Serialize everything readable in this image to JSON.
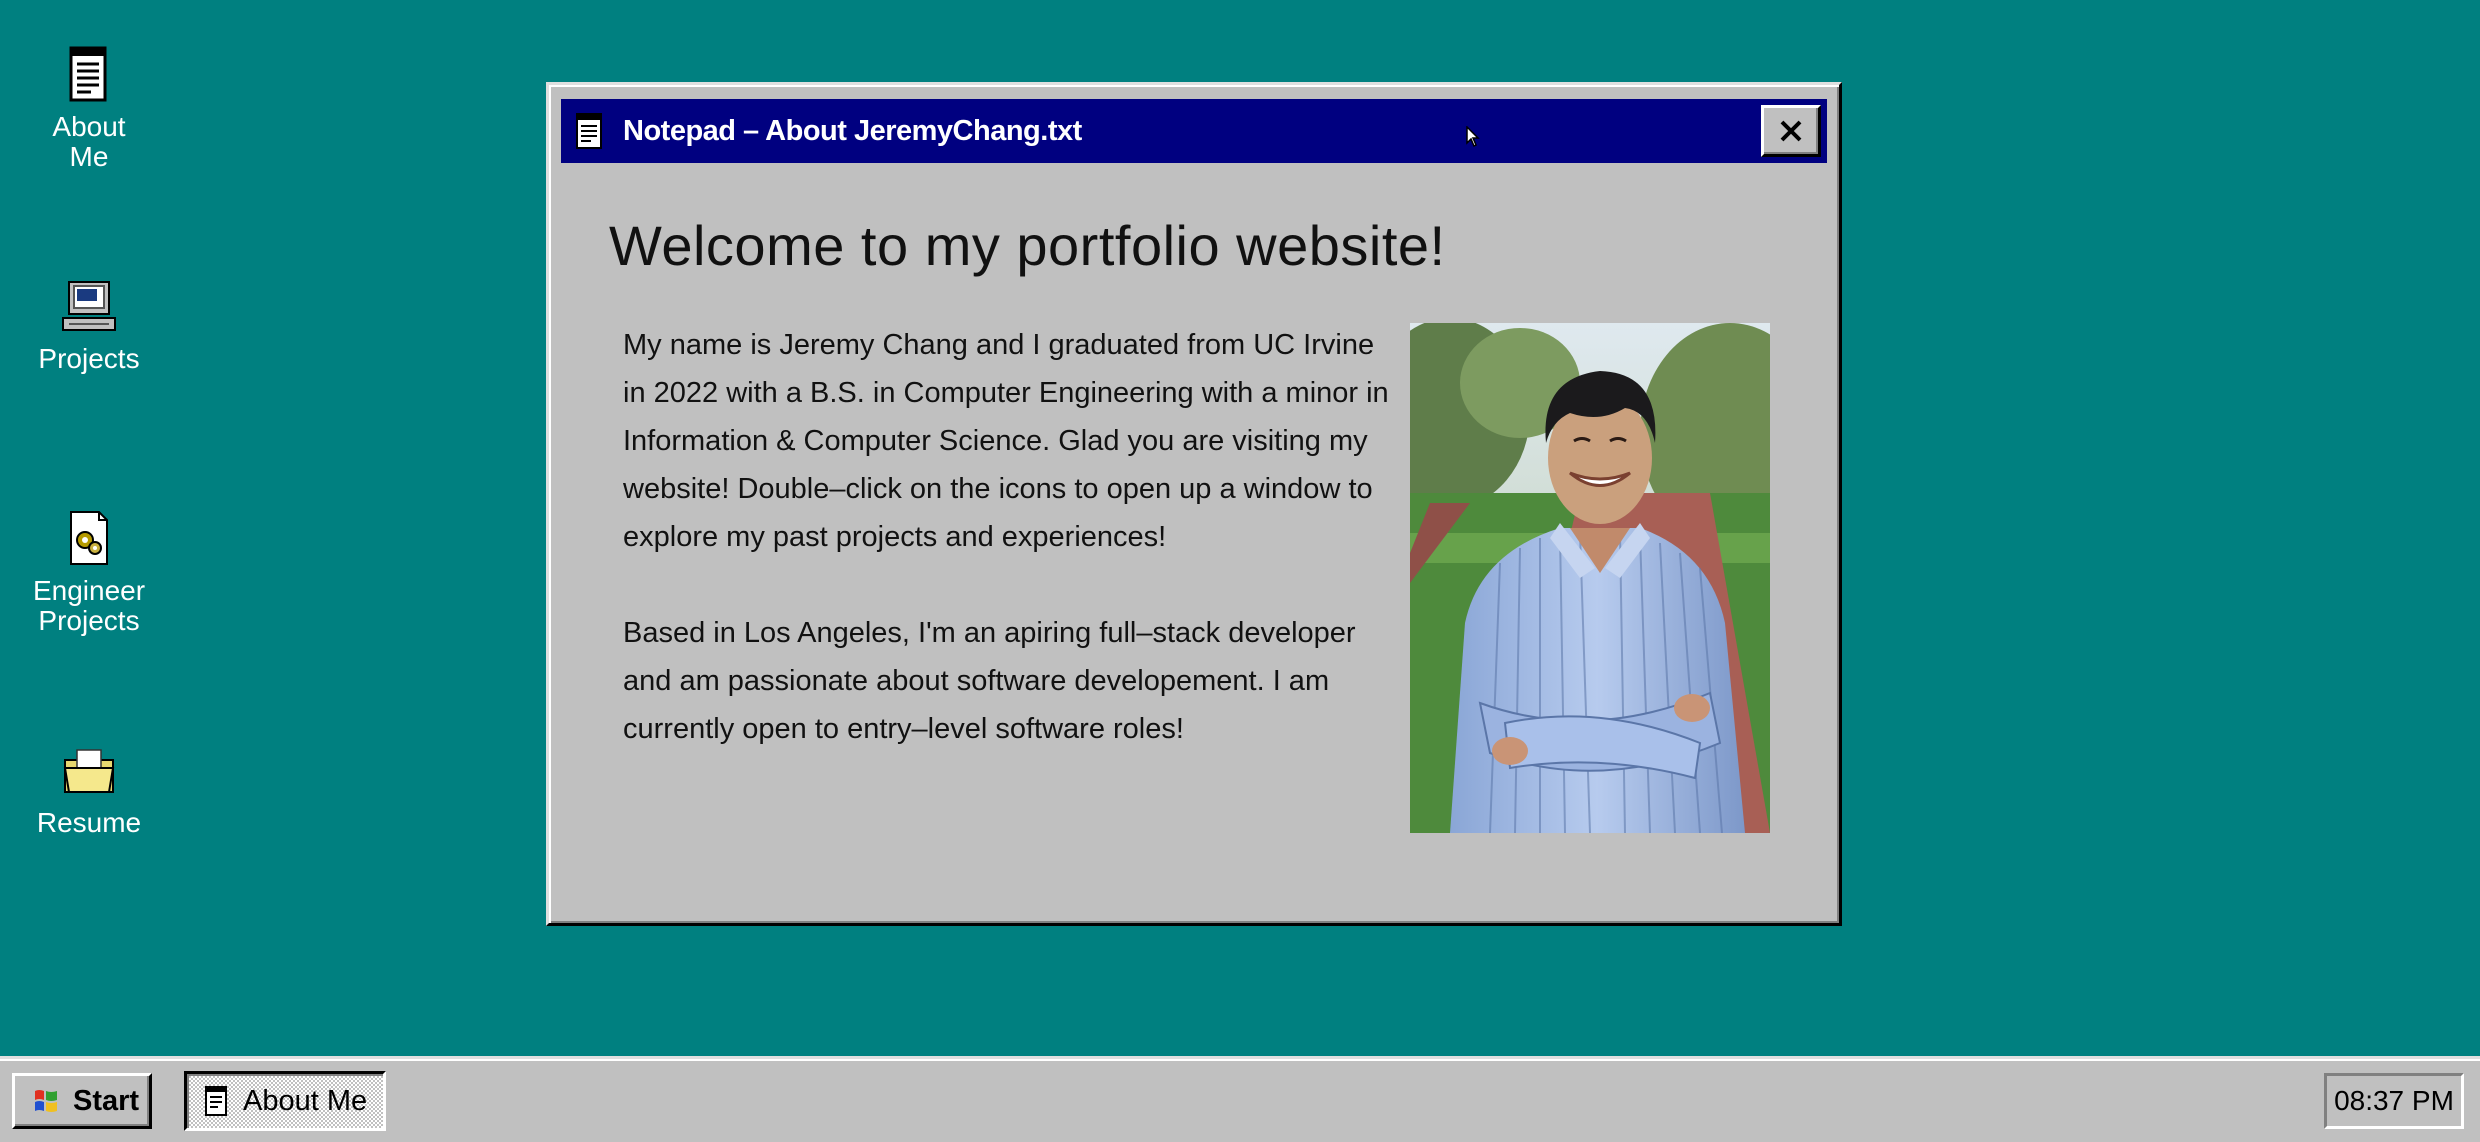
{
  "desktop": {
    "background": "#008080",
    "icons": [
      {
        "label": "About\nMe",
        "icon": "notepad-document-icon"
      },
      {
        "label": "Projects",
        "icon": "computer-icon"
      },
      {
        "label": "Engineer\nProjects",
        "icon": "settings-document-icon"
      },
      {
        "label": "Resume",
        "icon": "folder-icon"
      }
    ]
  },
  "window": {
    "title": "Notepad – About JeremyChang.txt",
    "title_bar_color": "#000080",
    "close_label": "✕",
    "heading": "Welcome to my portfolio website!",
    "paragraphs": [
      "My name is Jeremy Chang and I graduated from UC Irvine in 2022 with a B.S. in Computer Engineering with a minor in Information & Computer Science. Glad you are visiting my website! Double–click on the icons to open up a window to explore my past projects and experiences!",
      "Based in Los Angeles, I'm an apiring full–stack developer and am passionate about software developement. I am currently open to entry–level software roles!"
    ],
    "photo_icon": "portrait-photo"
  },
  "taskbar": {
    "start_label": "Start",
    "task_label": "About Me",
    "clock": "08:37 PM"
  }
}
